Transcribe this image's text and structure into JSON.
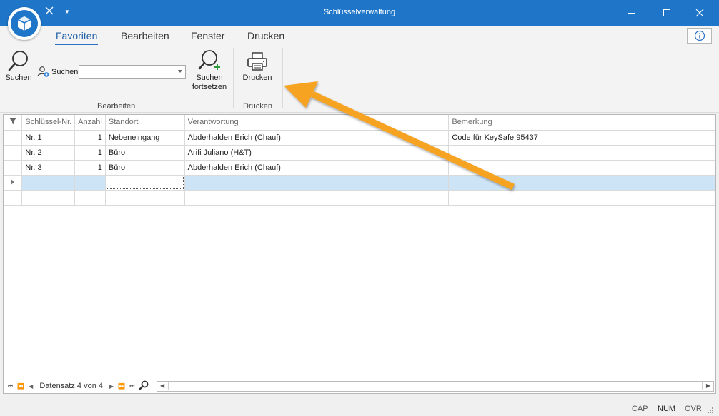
{
  "window": {
    "title": "Schlüsselverwaltung"
  },
  "ribbon_tabs": [
    "Favoriten",
    "Bearbeiten",
    "Fenster",
    "Drucken"
  ],
  "ribbon": {
    "search_label": "Suchen",
    "search_user_label": "Suchen",
    "search_continue_label_1": "Suchen",
    "search_continue_label_2": "fortsetzen",
    "group_edit": "Bearbeiten",
    "print_label": "Drucken",
    "group_print": "Drucken"
  },
  "grid": {
    "columns": [
      "Schlüssel-Nr.",
      "Anzahl",
      "Standort",
      "Verantwortung",
      "Bemerkung"
    ],
    "rows": [
      {
        "nr": "Nr. 1",
        "anzahl": "1",
        "standort": "Nebeneingang",
        "verantwortung": "Abderhalden Erich (Chauf)",
        "bemerkung": "Code für KeySafe 95437"
      },
      {
        "nr": "Nr. 2",
        "anzahl": "1",
        "standort": "Büro",
        "verantwortung": "Arifi Juliano (H&T)",
        "bemerkung": ""
      },
      {
        "nr": "Nr. 3",
        "anzahl": "1",
        "standort": "Büro",
        "verantwortung": "Abderhalden Erich (Chauf)",
        "bemerkung": ""
      }
    ],
    "record_nav": "Datensatz 4 von 4"
  },
  "statusbar": {
    "cap": "CAP",
    "num": "NUM",
    "ovr": "OVR"
  },
  "colors": {
    "titlebar": "#1f76c9",
    "arrow": "#f7a321",
    "focus_row": "#cde4f7"
  }
}
